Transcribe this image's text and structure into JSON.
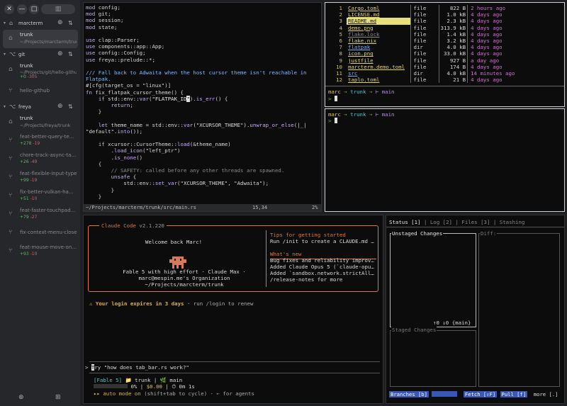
{
  "sidebar": {
    "workspaces": [
      {
        "name": "marcterm",
        "worktrees": [
          {
            "name": "trunk",
            "path": "~/Projects/marcterm/trunk",
            "active": true
          }
        ]
      },
      {
        "name": "git",
        "worktrees": [
          {
            "name": "trunk",
            "path": "~/Projects/git/hello-github",
            "added": "+0",
            "removed": "-305"
          },
          {
            "name": "hello-github"
          }
        ]
      },
      {
        "name": "freya",
        "worktrees": [
          {
            "name": "trunk",
            "path": "~/Projects/freya/trunk"
          },
          {
            "name": "feat-better-query-te...",
            "added": "+278",
            "removed": "-19"
          },
          {
            "name": "chore-track-async-ta...",
            "added": "+26",
            "removed": "-49"
          },
          {
            "name": "feat-flexible-input-type",
            "added": "+99",
            "removed": "-19"
          },
          {
            "name": "fix-better-vulkan-ha...",
            "added": "+51",
            "removed": "-10"
          },
          {
            "name": "feat-faster-touchpad...",
            "added": "+79",
            "removed": "-27"
          },
          {
            "name": "fix-context-menu-close"
          },
          {
            "name": "feat-mouse-move-on...",
            "added": "+93",
            "removed": "-10"
          }
        ]
      }
    ]
  },
  "editor": {
    "status_path": "~/Projects/marcterm/trunk/src/main.rs",
    "status_pos": "15,34",
    "status_scroll": "2%"
  },
  "files": {
    "rows": [
      {
        "idx": "1",
        "name": "Cargo.toml",
        "kind": "file",
        "size": "822 B",
        "modified": "2 hours ago"
      },
      {
        "idx": "2",
        "name": "LICENSE.md",
        "kind": "file",
        "size": "1.0 kB",
        "modified": "4 days ago"
      },
      {
        "idx": "3",
        "name": "README.md",
        "kind": "file",
        "size": "2.3 kB",
        "modified": "4 days ago"
      },
      {
        "idx": "4",
        "name": "demo.png",
        "kind": "file",
        "size": "313.9 kB",
        "modified": "4 days ago"
      },
      {
        "idx": "5",
        "name": "flake.lock",
        "kind": "file",
        "size": "1.4 kB",
        "modified": "4 days ago"
      },
      {
        "idx": "6",
        "name": "flake.nix",
        "kind": "file",
        "size": "3.2 kB",
        "modified": "4 days ago"
      },
      {
        "idx": "7",
        "name": "flatpak",
        "kind": "dir",
        "size": "4.0 kB",
        "modified": "4 days ago"
      },
      {
        "idx": "8",
        "name": "icon.png",
        "kind": "file",
        "size": "33.0 kB",
        "modified": "4 days ago"
      },
      {
        "idx": "9",
        "name": "justfile",
        "kind": "file",
        "size": "927 B",
        "modified": "a day ago"
      },
      {
        "idx": "10",
        "name": "marcterm.demo.toml",
        "kind": "file",
        "size": "174 B",
        "modified": "4 days ago"
      },
      {
        "idx": "11",
        "name": "src",
        "kind": "dir",
        "size": "4.0 kB",
        "modified": "14 minutes ago"
      },
      {
        "idx": "12",
        "name": "taplo.toml",
        "kind": "file",
        "size": "21 B",
        "modified": "4 days ago"
      }
    ],
    "prompt_user": "marc",
    "prompt_dir": "trunk",
    "prompt_branch": "main"
  },
  "shell": {
    "prompt_user": "marc",
    "prompt_dir": "trunk",
    "prompt_branch": "main"
  },
  "claude": {
    "title": "Claude Code",
    "version": "v2.1.220",
    "welcome": "Welcome back Marc!",
    "model_line": "Fable 5 with high effort · Claude Max ·",
    "org_line": "marc@mespin.me's Organization",
    "cwd": "~/Projects/marcterm/trunk",
    "tips_title": "Tips for getting started",
    "tips_text": "Run /init to create a CLAUDE.md …",
    "news_title": "What's new",
    "news_1": "Bug fixes and reliability improv…",
    "news_2": "Added Claude Opus 5 (`claude-opu…",
    "news_3": "Added `sandbox.network.strictAll…",
    "news_4": "/release-notes for more",
    "login_warn": "Your login expires in 3 days",
    "login_hint": "· run /login to renew",
    "input_text": "ry \"how does tab_bar.rs work?\"",
    "input_cursor": "T",
    "status_model": "[Fable 5]",
    "status_dir": "trunk",
    "status_branch": "main",
    "status_pct": "0%",
    "status_cost": "$0.00",
    "status_time": "0m 1s",
    "mode_label": "auto mode on",
    "mode_hint": "(shift+tab to cycle) · ← for agents"
  },
  "git": {
    "tabs": [
      "Status [1]",
      "Log [2]",
      "Files [3]",
      "Stashing"
    ],
    "unstaged_label": "Unstaged Changes",
    "diff_label": "Diff:",
    "staged_label": "Staged Changes",
    "ahead_behind": "↑0 ↓0 {main}",
    "branches_btn": "Branches [b]",
    "fetch_btn": "Fetch [⇧F]",
    "pull_btn": "Pull [f]",
    "more_btn": "more [.]"
  },
  "colors": {
    "claude_accent": "#d77a3a",
    "git_button": "#3a57b8",
    "prompt_user": "#e0c060",
    "prompt_dir": "#5ac0c0",
    "prompt_branch": "#b090e0"
  }
}
